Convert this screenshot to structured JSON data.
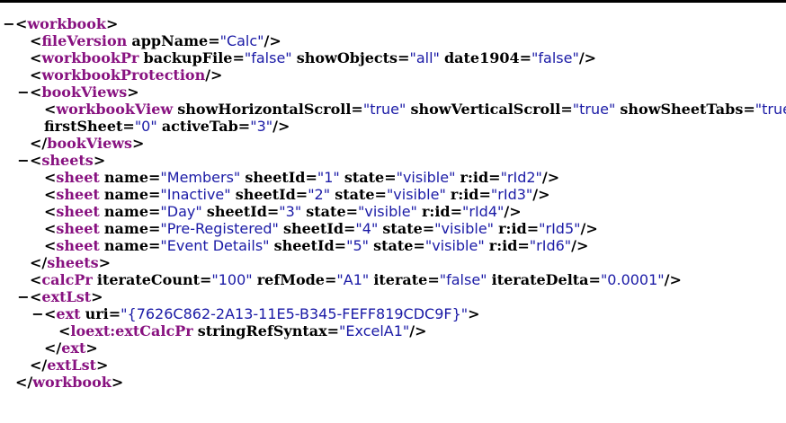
{
  "lines": [
    {
      "indent": 0,
      "fold": "−",
      "parts": [
        [
          "punc",
          "<"
        ],
        [
          "tag",
          "workbook"
        ],
        [
          "punc",
          ">"
        ]
      ]
    },
    {
      "indent": 1,
      "fold": "",
      "parts": [
        [
          "punc",
          "<"
        ],
        [
          "tag",
          "fileVersion"
        ],
        [
          "sp",
          " "
        ],
        [
          "attr",
          "appName"
        ],
        [
          "punc",
          "="
        ],
        [
          "val",
          "\"Calc\""
        ],
        [
          "punc",
          "/>"
        ]
      ]
    },
    {
      "indent": 1,
      "fold": "",
      "parts": [
        [
          "punc",
          "<"
        ],
        [
          "tag",
          "workbookPr"
        ],
        [
          "sp",
          " "
        ],
        [
          "attr",
          "backupFile"
        ],
        [
          "punc",
          "="
        ],
        [
          "val",
          "\"false\""
        ],
        [
          "sp",
          " "
        ],
        [
          "attr",
          "showObjects"
        ],
        [
          "punc",
          "="
        ],
        [
          "val",
          "\"all\""
        ],
        [
          "sp",
          " "
        ],
        [
          "attr",
          "date1904"
        ],
        [
          "punc",
          "="
        ],
        [
          "val",
          "\"false\""
        ],
        [
          "punc",
          "/>"
        ]
      ]
    },
    {
      "indent": 1,
      "fold": "",
      "parts": [
        [
          "punc",
          "<"
        ],
        [
          "tag",
          "workbookProtection"
        ],
        [
          "punc",
          "/>"
        ]
      ]
    },
    {
      "indent": 1,
      "fold": "−",
      "parts": [
        [
          "punc",
          "<"
        ],
        [
          "tag",
          "bookViews"
        ],
        [
          "punc",
          ">"
        ]
      ]
    },
    {
      "indent": 2,
      "fold": "",
      "parts": [
        [
          "punc",
          "<"
        ],
        [
          "tag",
          "workbookView"
        ],
        [
          "sp",
          " "
        ],
        [
          "attr",
          "showHorizontalScroll"
        ],
        [
          "punc",
          "="
        ],
        [
          "val",
          "\"true\""
        ],
        [
          "sp",
          " "
        ],
        [
          "attr",
          "showVerticalScroll"
        ],
        [
          "punc",
          "="
        ],
        [
          "val",
          "\"true\""
        ],
        [
          "sp",
          " "
        ],
        [
          "attr",
          "showSheetTabs"
        ],
        [
          "punc",
          "="
        ],
        [
          "val",
          "\"true\""
        ]
      ]
    },
    {
      "indent": 2,
      "fold": "",
      "parts": [
        [
          "attr",
          "firstSheet"
        ],
        [
          "punc",
          "="
        ],
        [
          "val",
          "\"0\""
        ],
        [
          "sp",
          " "
        ],
        [
          "attr",
          "activeTab"
        ],
        [
          "punc",
          "="
        ],
        [
          "val",
          "\"3\""
        ],
        [
          "punc",
          "/>"
        ]
      ]
    },
    {
      "indent": 1,
      "fold": "",
      "parts": [
        [
          "punc",
          "</"
        ],
        [
          "tag",
          "bookViews"
        ],
        [
          "punc",
          ">"
        ]
      ]
    },
    {
      "indent": 1,
      "fold": "−",
      "parts": [
        [
          "punc",
          "<"
        ],
        [
          "tag",
          "sheets"
        ],
        [
          "punc",
          ">"
        ]
      ]
    },
    {
      "indent": 2,
      "fold": "",
      "parts": [
        [
          "punc",
          "<"
        ],
        [
          "tag",
          "sheet"
        ],
        [
          "sp",
          " "
        ],
        [
          "attr",
          "name"
        ],
        [
          "punc",
          "="
        ],
        [
          "val",
          "\"Members\""
        ],
        [
          "sp",
          " "
        ],
        [
          "attr",
          "sheetId"
        ],
        [
          "punc",
          "="
        ],
        [
          "val",
          "\"1\""
        ],
        [
          "sp",
          " "
        ],
        [
          "attr",
          "state"
        ],
        [
          "punc",
          "="
        ],
        [
          "val",
          "\"visible\""
        ],
        [
          "sp",
          " "
        ],
        [
          "attr",
          "r:id"
        ],
        [
          "punc",
          "="
        ],
        [
          "val",
          "\"rId2\""
        ],
        [
          "punc",
          "/>"
        ]
      ]
    },
    {
      "indent": 2,
      "fold": "",
      "parts": [
        [
          "punc",
          "<"
        ],
        [
          "tag",
          "sheet"
        ],
        [
          "sp",
          " "
        ],
        [
          "attr",
          "name"
        ],
        [
          "punc",
          "="
        ],
        [
          "val",
          "\"Inactive\""
        ],
        [
          "sp",
          " "
        ],
        [
          "attr",
          "sheetId"
        ],
        [
          "punc",
          "="
        ],
        [
          "val",
          "\"2\""
        ],
        [
          "sp",
          " "
        ],
        [
          "attr",
          "state"
        ],
        [
          "punc",
          "="
        ],
        [
          "val",
          "\"visible\""
        ],
        [
          "sp",
          " "
        ],
        [
          "attr",
          "r:id"
        ],
        [
          "punc",
          "="
        ],
        [
          "val",
          "\"rId3\""
        ],
        [
          "punc",
          "/>"
        ]
      ]
    },
    {
      "indent": 2,
      "fold": "",
      "parts": [
        [
          "punc",
          "<"
        ],
        [
          "tag",
          "sheet"
        ],
        [
          "sp",
          " "
        ],
        [
          "attr",
          "name"
        ],
        [
          "punc",
          "="
        ],
        [
          "val",
          "\"Day\""
        ],
        [
          "sp",
          " "
        ],
        [
          "attr",
          "sheetId"
        ],
        [
          "punc",
          "="
        ],
        [
          "val",
          "\"3\""
        ],
        [
          "sp",
          " "
        ],
        [
          "attr",
          "state"
        ],
        [
          "punc",
          "="
        ],
        [
          "val",
          "\"visible\""
        ],
        [
          "sp",
          " "
        ],
        [
          "attr",
          "r:id"
        ],
        [
          "punc",
          "="
        ],
        [
          "val",
          "\"rId4\""
        ],
        [
          "punc",
          "/>"
        ]
      ]
    },
    {
      "indent": 2,
      "fold": "",
      "parts": [
        [
          "punc",
          "<"
        ],
        [
          "tag",
          "sheet"
        ],
        [
          "sp",
          " "
        ],
        [
          "attr",
          "name"
        ],
        [
          "punc",
          "="
        ],
        [
          "val",
          "\"Pre-Registered\""
        ],
        [
          "sp",
          " "
        ],
        [
          "attr",
          "sheetId"
        ],
        [
          "punc",
          "="
        ],
        [
          "val",
          "\"4\""
        ],
        [
          "sp",
          " "
        ],
        [
          "attr",
          "state"
        ],
        [
          "punc",
          "="
        ],
        [
          "val",
          "\"visible\""
        ],
        [
          "sp",
          " "
        ],
        [
          "attr",
          "r:id"
        ],
        [
          "punc",
          "="
        ],
        [
          "val",
          "\"rId5\""
        ],
        [
          "punc",
          "/>"
        ]
      ]
    },
    {
      "indent": 2,
      "fold": "",
      "parts": [
        [
          "punc",
          "<"
        ],
        [
          "tag",
          "sheet"
        ],
        [
          "sp",
          " "
        ],
        [
          "attr",
          "name"
        ],
        [
          "punc",
          "="
        ],
        [
          "val",
          "\"Event Details\""
        ],
        [
          "sp",
          " "
        ],
        [
          "attr",
          "sheetId"
        ],
        [
          "punc",
          "="
        ],
        [
          "val",
          "\"5\""
        ],
        [
          "sp",
          " "
        ],
        [
          "attr",
          "state"
        ],
        [
          "punc",
          "="
        ],
        [
          "val",
          "\"visible\""
        ],
        [
          "sp",
          " "
        ],
        [
          "attr",
          "r:id"
        ],
        [
          "punc",
          "="
        ],
        [
          "val",
          "\"rId6\""
        ],
        [
          "punc",
          "/>"
        ]
      ]
    },
    {
      "indent": 1,
      "fold": "",
      "parts": [
        [
          "punc",
          "</"
        ],
        [
          "tag",
          "sheets"
        ],
        [
          "punc",
          ">"
        ]
      ]
    },
    {
      "indent": 1,
      "fold": "",
      "parts": [
        [
          "punc",
          "<"
        ],
        [
          "tag",
          "calcPr"
        ],
        [
          "sp",
          " "
        ],
        [
          "attr",
          "iterateCount"
        ],
        [
          "punc",
          "="
        ],
        [
          "val",
          "\"100\""
        ],
        [
          "sp",
          " "
        ],
        [
          "attr",
          "refMode"
        ],
        [
          "punc",
          "="
        ],
        [
          "val",
          "\"A1\""
        ],
        [
          "sp",
          " "
        ],
        [
          "attr",
          "iterate"
        ],
        [
          "punc",
          "="
        ],
        [
          "val",
          "\"false\""
        ],
        [
          "sp",
          " "
        ],
        [
          "attr",
          "iterateDelta"
        ],
        [
          "punc",
          "="
        ],
        [
          "val",
          "\"0.0001\""
        ],
        [
          "punc",
          "/>"
        ]
      ]
    },
    {
      "indent": 1,
      "fold": "−",
      "parts": [
        [
          "punc",
          "<"
        ],
        [
          "tag",
          "extLst"
        ],
        [
          "punc",
          ">"
        ]
      ]
    },
    {
      "indent": 2,
      "fold": "−",
      "parts": [
        [
          "punc",
          "<"
        ],
        [
          "tag",
          "ext"
        ],
        [
          "sp",
          " "
        ],
        [
          "attr",
          "uri"
        ],
        [
          "punc",
          "="
        ],
        [
          "val",
          "\"{7626C862-2A13-11E5-B345-FEFF819CDC9F}\""
        ],
        [
          "punc",
          ">"
        ]
      ]
    },
    {
      "indent": 3,
      "fold": "",
      "parts": [
        [
          "punc",
          "<"
        ],
        [
          "tag",
          "loext:extCalcPr"
        ],
        [
          "sp",
          " "
        ],
        [
          "attr",
          "stringRefSyntax"
        ],
        [
          "punc",
          "="
        ],
        [
          "val",
          "\"ExcelA1\""
        ],
        [
          "punc",
          "/>"
        ]
      ]
    },
    {
      "indent": 2,
      "fold": "",
      "parts": [
        [
          "punc",
          "</"
        ],
        [
          "tag",
          "ext"
        ],
        [
          "punc",
          ">"
        ]
      ]
    },
    {
      "indent": 1,
      "fold": "",
      "parts": [
        [
          "punc",
          "</"
        ],
        [
          "tag",
          "extLst"
        ],
        [
          "punc",
          ">"
        ]
      ]
    },
    {
      "indent": 0,
      "fold": "",
      "parts": [
        [
          "punc",
          "</"
        ],
        [
          "tag",
          "workbook"
        ],
        [
          "punc",
          ">"
        ]
      ]
    }
  ],
  "colors": {
    "tag": "#881280",
    "value": "#1a1aa6",
    "text": "#000000",
    "background": "#ffffff"
  }
}
